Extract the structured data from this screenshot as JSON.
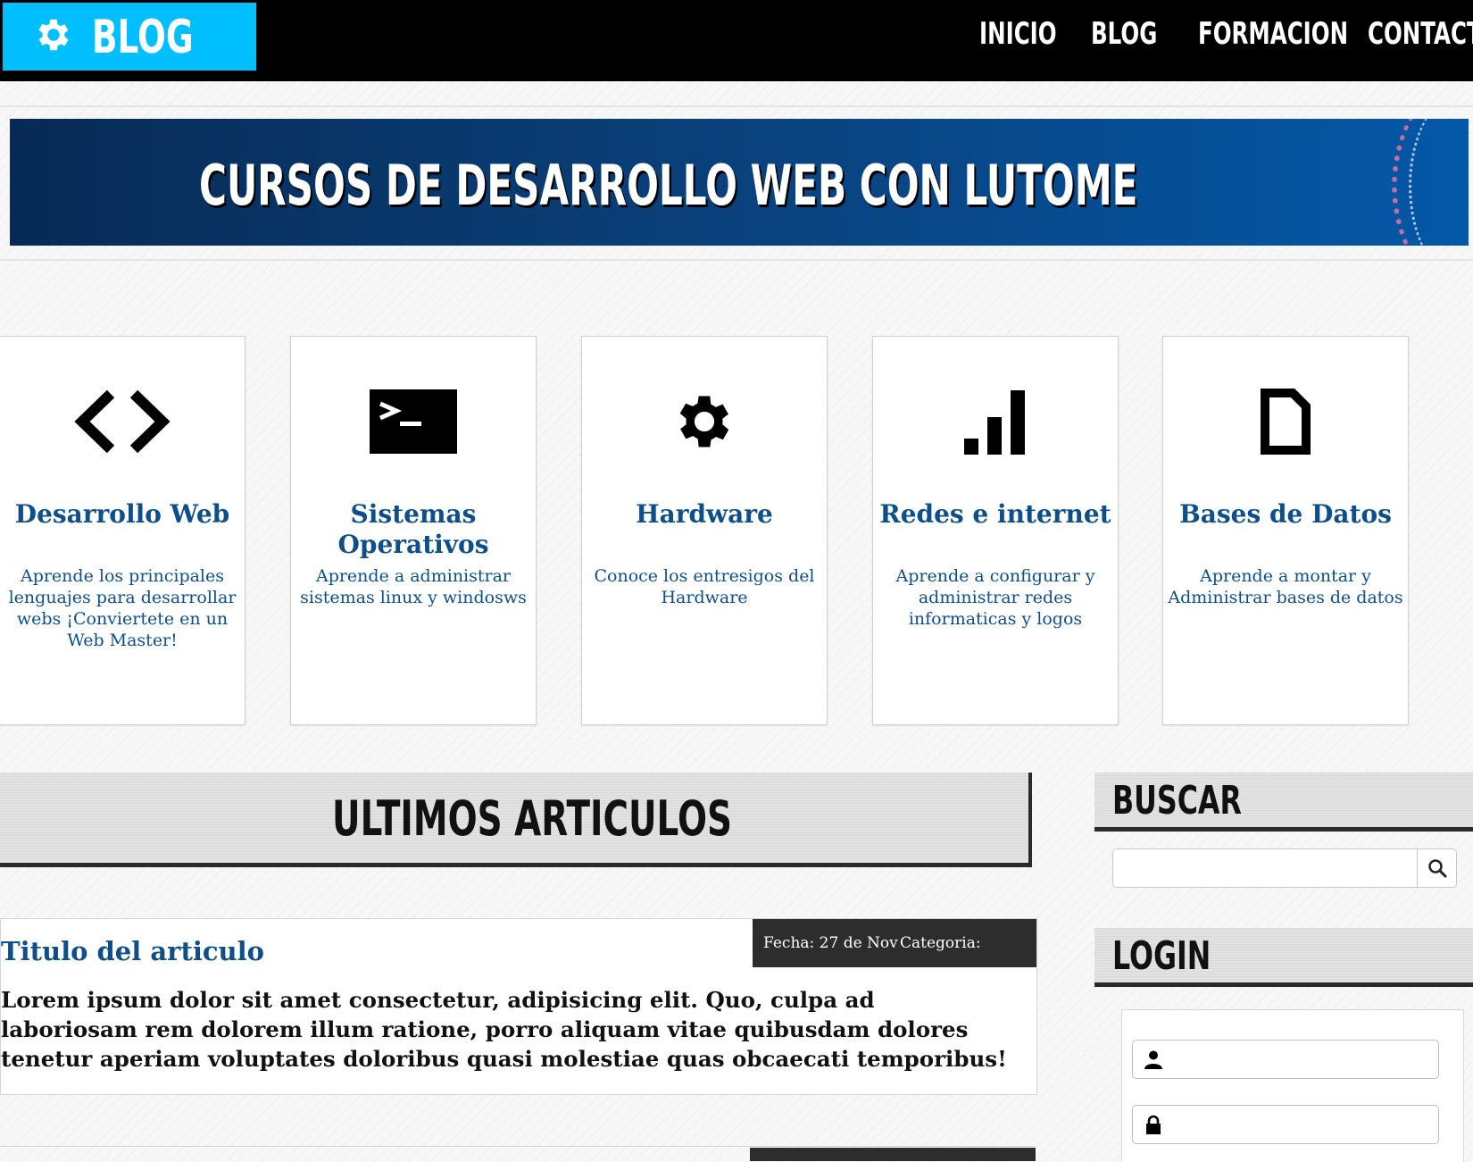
{
  "header": {
    "logo_text": "BLOG",
    "nav": [
      "INICIO",
      "BLOG",
      "FORMACION",
      "CONTACTO"
    ]
  },
  "banner": {
    "title": "CURSOS DE DESARROLLO WEB CON LUTOME"
  },
  "cards": [
    {
      "icon": "code-icon",
      "title": "Desarrollo Web",
      "desc": "Aprende los principales lenguajes para desarrollar webs ¡Conviertete en un Web Master!"
    },
    {
      "icon": "terminal-icon",
      "title": "Sistemas Operativos",
      "desc": "Aprende a administrar sistemas linux y windosws"
    },
    {
      "icon": "gear-icon",
      "title": "Hardware",
      "desc": "Conoce los entresigos del Hardware"
    },
    {
      "icon": "signal-bars-icon",
      "title": "Redes e internet",
      "desc": "Aprende a configurar y administrar redes informaticas y logos"
    },
    {
      "icon": "file-icon",
      "title": "Bases de Datos",
      "desc": "Aprende a montar y Administrar bases de datos"
    }
  ],
  "articles_section": {
    "heading": "ULTIMOS ARTICULOS",
    "articles": [
      {
        "date": "Fecha: 27 de Nov",
        "category": "Categoria: Pruebas",
        "title": "Titulo del articulo",
        "body": "Lorem ipsum dolor sit amet consectetur, adipisicing elit. Quo, culpa ad laboriosam rem dolorem illum ratione, porro aliquam vitae quibusdam dolores tenetur aperiam voluptates doloribus quasi molestiae quas obcaecati temporibus!"
      }
    ]
  },
  "sidebar": {
    "search_heading": "BUSCAR",
    "search_value": "",
    "login_heading": "LOGIN",
    "username_value": "",
    "password_value": ""
  },
  "colors": {
    "accent": "#00bfff",
    "title_blue": "#0e4f8a",
    "dark": "#2d2d2d"
  }
}
